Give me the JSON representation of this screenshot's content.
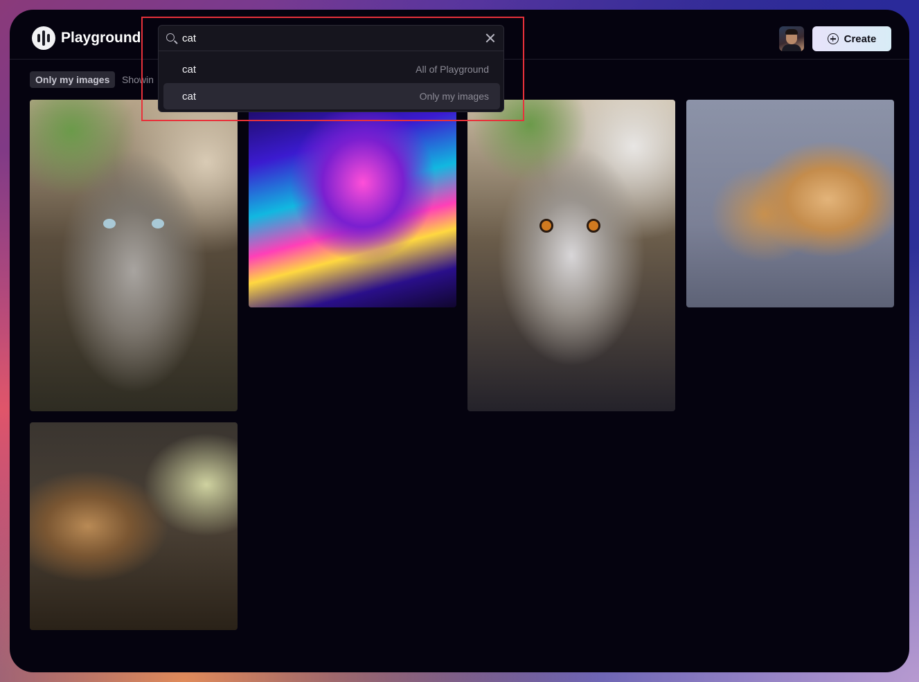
{
  "header": {
    "app_name": "Playground",
    "create_label": "Create"
  },
  "filters": {
    "chip_label": "Only my images",
    "showing_text": "Showin"
  },
  "search": {
    "query": "cat",
    "options": [
      {
        "label": "cat",
        "scope": "All of Playground"
      },
      {
        "label": "cat",
        "scope": "Only my images"
      }
    ]
  },
  "colors": {
    "background": "#05030f",
    "highlight_border": "#e8313a",
    "create_button": "#e7e3fa"
  },
  "icons": [
    "logo-icon",
    "search-icon",
    "close-icon",
    "plus-circle-icon"
  ]
}
